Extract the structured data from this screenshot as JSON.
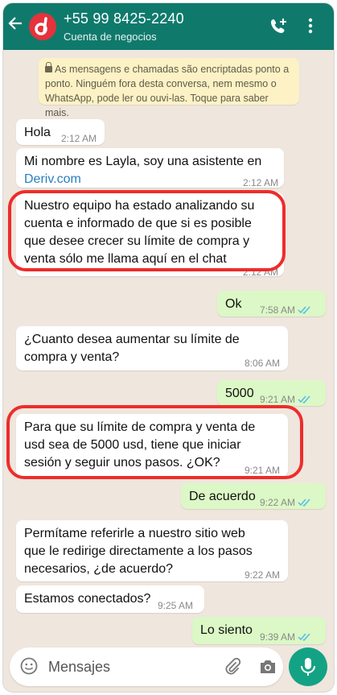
{
  "header": {
    "back_icon": "arrow-left-icon",
    "contact_name": "+55 99 8425-2240",
    "subtitle": "Cuenta de negocios",
    "call_icon": "add-call-icon",
    "menu_icon": "more-vertical-icon"
  },
  "encryption_notice": "As mensagens e chamadas são encriptadas ponto a ponto. Ninguém fora desta conversa, nem mesmo o WhatsApp, pode ler ou ouvi-las. Toque para saber mais.",
  "messages": [
    {
      "dir": "in",
      "text": "Hola",
      "time": "2:12 AM"
    },
    {
      "dir": "in",
      "text_line1": "Mi nombre es Layla, soy una asistente en",
      "link": "Deriv.com",
      "time": "2:12 AM"
    },
    {
      "dir": "in",
      "text": "Nuestro equipo ha estado analizando su cuenta e informado de que si es posible que desee crecer su límite de compra y venta sólo me llama aquí en el chat",
      "time": "2:12 AM"
    },
    {
      "dir": "out",
      "text": "Ok",
      "time": "7:58 AM"
    },
    {
      "dir": "in",
      "text": "¿Cuanto desea aumentar su límite de compra y venta?",
      "time": "8:06 AM"
    },
    {
      "dir": "out",
      "text": "5000",
      "time": "9:21 AM"
    },
    {
      "dir": "in",
      "text": "Para que su límite de compra y venta de usd sea de 5000 usd, tiene que iniciar sesión y seguir unos pasos. ¿OK?",
      "time": "9:21 AM"
    },
    {
      "dir": "out",
      "text": "De acuerdo",
      "time": "9:22 AM"
    },
    {
      "dir": "in",
      "text": "Permítame referirle a nuestro sitio web que le redirige directamente a los pasos necesarios, ¿de acuerdo?",
      "time": "9:22 AM"
    },
    {
      "dir": "in",
      "text": "Estamos conectados?",
      "time": "9:25 AM"
    },
    {
      "dir": "out",
      "text": "Lo siento",
      "time": "9:39 AM"
    }
  ],
  "composer": {
    "placeholder": "Mensajes",
    "emoji_icon": "emoji-icon",
    "attach_icon": "paperclip-icon",
    "camera_icon": "camera-icon",
    "mic_icon": "microphone-icon"
  },
  "colors": {
    "header": "#0f7a6c",
    "outgoing_bubble": "#dcf8c6",
    "highlight": "#ee2c2c",
    "read_ticks": "#53bdeb"
  }
}
